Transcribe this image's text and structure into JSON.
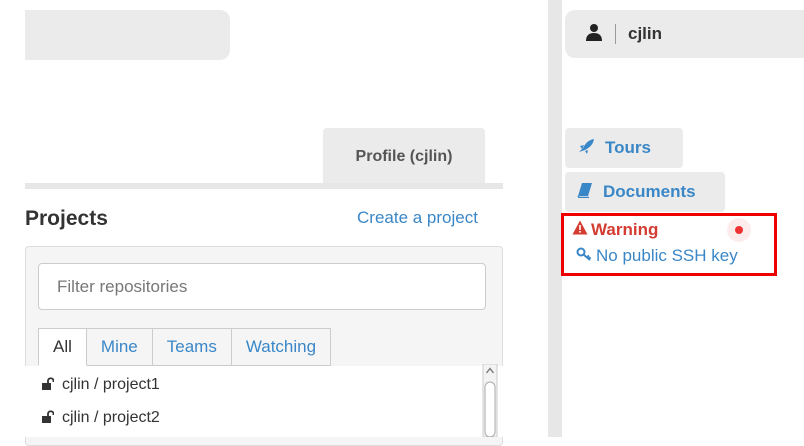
{
  "header": {
    "username": "cjlin"
  },
  "profile_tab": {
    "label": "Profile (cjlin)"
  },
  "projects": {
    "title": "Projects",
    "create_link": "Create a project",
    "filter_placeholder": "Filter repositories",
    "tabs": [
      {
        "label": "All",
        "active": true
      },
      {
        "label": "Mine"
      },
      {
        "label": "Teams"
      },
      {
        "label": "Watching"
      }
    ],
    "items": [
      {
        "name": "cjlin / project1",
        "icon": "unlock-icon"
      },
      {
        "name": "cjlin / project2",
        "icon": "unlock-icon"
      }
    ]
  },
  "sidebar": {
    "tours_label": "Tours",
    "documents_label": "Documents",
    "warning": {
      "title": "Warning",
      "message": "No public SSH key"
    }
  },
  "colors": {
    "link": "#3a87c8",
    "warning": "#d43c32",
    "highlight_border": "#e00000"
  }
}
